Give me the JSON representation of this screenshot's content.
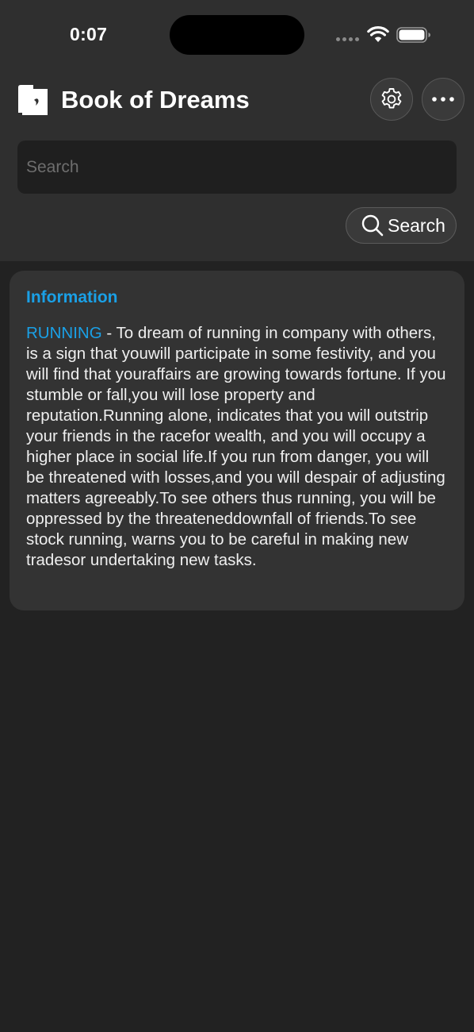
{
  "status_bar": {
    "time": "0:07"
  },
  "header": {
    "title": "Book of Dreams",
    "logo_icon": "moon-book-icon",
    "settings_icon": "gear-icon",
    "more_icon": "ellipsis-icon"
  },
  "search": {
    "placeholder": "Search",
    "value": "",
    "button_label": "Search",
    "button_icon": "magnifier-icon"
  },
  "info_card": {
    "heading": "Information",
    "keyword": "RUNNING",
    "separator": " - ",
    "text": "To dream of running in company with others, is a sign that youwill participate in some festivity, and you will find that youraffairs are growing towards fortune.  If you stumble or fall,you will lose property and reputation.Running alone, indicates that you will outstrip your friends in the racefor wealth, and you will occupy a higher place in social life.If you run from danger, you will be threatened with losses,and you will despair of adjusting matters agreeably.To see others thus running, you will be oppressed by the threateneddownfall of friends.To see stock running, warns you to be careful in making new tradesor undertaking new tasks."
  },
  "colors": {
    "accent": "#1aa0e6",
    "background": "#222222",
    "header_background": "#2f2f2f",
    "card_background": "#333333"
  }
}
